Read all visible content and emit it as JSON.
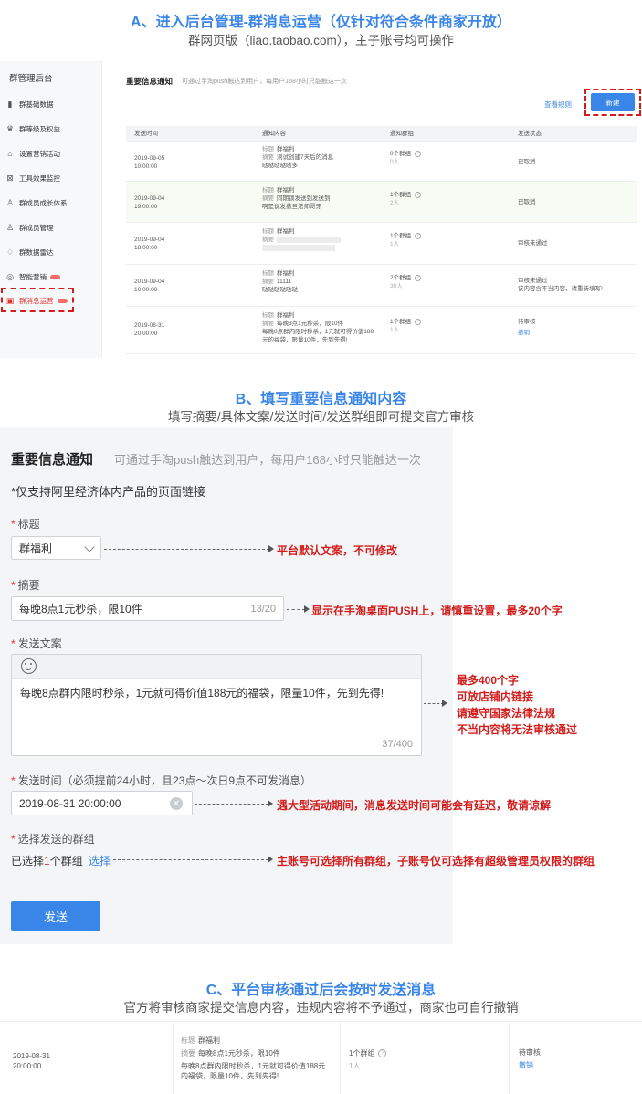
{
  "sectionA": {
    "title": "A、进入后台管理-群消息运营（仅针对符合条件商家开放）",
    "subtitle": "群网页版（liao.taobao.com），主子账号均可操作",
    "sidebar": {
      "header": "群管理后台",
      "items": [
        {
          "label": "群基础数据",
          "icon": "bar-chart-icon"
        },
        {
          "label": "群等级及权益",
          "icon": "crown-icon"
        },
        {
          "label": "设置营销活动",
          "icon": "bag-icon"
        },
        {
          "label": "工具效果监控",
          "icon": "monitor-icon"
        },
        {
          "label": "群成员成长体系",
          "icon": "user-growth-icon"
        },
        {
          "label": "群成员管理",
          "icon": "user-icon"
        },
        {
          "label": "群数据雷达",
          "icon": "radar-icon"
        },
        {
          "label": "智能营销",
          "icon": "smart-icon"
        },
        {
          "label": "群消息运营",
          "icon": "message-icon"
        }
      ]
    },
    "main": {
      "title": "重要信息通知",
      "desc": "可通过手淘push触达到用户，每用户168小时只能触达一次",
      "rule_link": "查看规则",
      "new_button": "新建",
      "columns": [
        "发送时间",
        "通知内容",
        "通知群组",
        "发送状态"
      ],
      "rows": [
        {
          "date": "2019-09-05",
          "time": "10:00:00",
          "title_label": "标题",
          "title": "群福利",
          "summary_label": "摘要",
          "summary": "测试创建7天后的消息",
          "body": "哒哒哒哒哒多",
          "groups": "0个群组",
          "members": "0人",
          "status": "已取消",
          "status_note": "",
          "action": ""
        },
        {
          "date": "2019-09-04",
          "time": "19:00:00",
          "title_label": "标题",
          "title": "群福利",
          "summary_label": "摘要",
          "summary": "同期锁发送到发送到",
          "body": "啊是说发撒旦法师哥牙",
          "groups": "1个群组",
          "members": "2人",
          "status": "已取消",
          "status_note": "",
          "action": ""
        },
        {
          "date": "2019-09-04",
          "time": "18:00:00",
          "title_label": "标题",
          "title": "群福利",
          "summary_label": "摘要",
          "summary": "",
          "body": "",
          "groups": "1个群组",
          "members": "1人",
          "status": "审核未通过",
          "status_note": "",
          "action": ""
        },
        {
          "date": "2019-09-04",
          "time": "10:00:00",
          "title_label": "标题",
          "title": "群福利",
          "summary_label": "摘要",
          "summary": "11111",
          "body": "哒哒哒哒哒哒",
          "groups": "2个群组",
          "members": "30人",
          "status": "审核未通过",
          "status_note": "该内容含不当内容，请重新填写!",
          "action": ""
        },
        {
          "date": "2019-08-31",
          "time": "20:00:00",
          "title_label": "标题",
          "title": "群福利",
          "summary_label": "摘要",
          "summary": "每晚8点1元秒杀，限10件",
          "body": "每晚8点群内限时秒杀，1元就可得价值188元的福袋，限量10件，先到先得!",
          "groups": "1个群组",
          "members": "1人",
          "status": "待审核",
          "status_note": "",
          "action": "撤销"
        }
      ]
    }
  },
  "sectionB": {
    "title": "B、填写重要信息通知内容",
    "subtitle": "填写摘要/具体文案/发送时间/发送群组即可提交官方审核",
    "form": {
      "title": "重要信息通知",
      "desc": "可通过手淘push触达到用户，每用户168小时只能触达一次",
      "note": "*仅支持阿里经济体内产品的页面链接",
      "required_mark": "*",
      "title_label": "标题",
      "title_value": "群福利",
      "summary_label": "摘要",
      "summary_value": "每晚8点1元秒杀，限10件",
      "summary_count": "13/20",
      "copy_label": "发送文案",
      "copy_value": "每晚8点群内限时秒杀，1元就可得价值188元的福袋，限量10件，先到先得!",
      "copy_count": "37/400",
      "time_label": "发送时间（必须提前24小时，且23点～次日9点不可发消息）",
      "time_value": "2019-08-31 20:00:00",
      "group_label": "选择发送的群组",
      "group_prefix": "已选择",
      "group_count": "1",
      "group_suffix": "个群组",
      "group_link": "选择",
      "send_button": "发送"
    },
    "annotations": {
      "title_note": "平台默认文案，不可修改",
      "summary_note": "显示在手淘桌面PUSH上，请慎重设置，最多20个字",
      "copy_note": [
        "最多400个字",
        "可放店铺内链接",
        "请遵守国家法律法规",
        "不当内容将无法审核通过"
      ],
      "time_note": "遇大型活动期间，消息发送时间可能会有延迟，敬请谅解",
      "group_note": "主账号可选择所有群组，子账号仅可选择有超级管理员权限的群组"
    }
  },
  "sectionC": {
    "title": "C、平台审核通过后会按时发送消息",
    "subtitle": "官方将审核商家提交信息内容，违规内容将不予通过，商家也可自行撤销",
    "row": {
      "date": "2019-08-31",
      "time": "20:00:00",
      "title_label": "标题",
      "title": "群福利",
      "summary_label": "摘要",
      "summary": "每晚8点1元秒杀，限10件",
      "body": "每晚8点群内限时秒杀，1元就可得价值188元的福袋，限量10件，先到先得!",
      "groups": "1个群组",
      "members": "1人",
      "status": "待审核",
      "action": "撤销"
    }
  },
  "colors": {
    "accent": "#3a86e8",
    "annotation": "#d21d1d",
    "required": "#e5322d"
  }
}
